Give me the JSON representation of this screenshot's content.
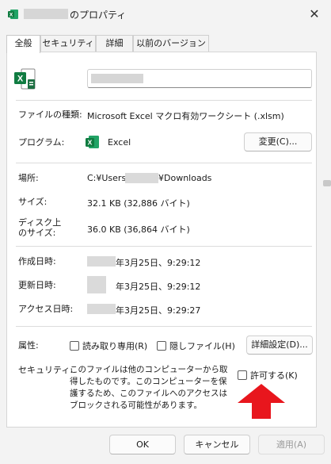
{
  "window": {
    "title_suffix": "のプロパティ",
    "close_glyph": "✕"
  },
  "tabs": [
    {
      "label": "全般",
      "active": true
    },
    {
      "label": "セキュリティ",
      "active": false
    },
    {
      "label": "詳細",
      "active": false
    },
    {
      "label": "以前のバージョン",
      "active": false
    }
  ],
  "general": {
    "file_type_label": "ファイルの種類:",
    "file_type_value": "Microsoft Excel マクロ有効ワークシート (.xlsm)",
    "program_label": "プログラム:",
    "program_value": "Excel",
    "change_button": "変更(C)...",
    "location_label": "場所:",
    "location_prefix": "C:¥Users¥",
    "location_suffix": "¥Downloads",
    "size_label": "サイズ:",
    "size_value": "32.1 KB (32,886 バイト)",
    "disk_size_label_1": "ディスク上",
    "disk_size_label_2": "のサイズ:",
    "disk_size_value": "36.0 KB (36,864 バイト)",
    "created_label": "作成日時:",
    "created_value": "年3月25日、9:29:12",
    "modified_label": "更新日時:",
    "modified_value": "年3月25日、9:29:12",
    "accessed_label": "アクセス日時:",
    "accessed_value": "年3月25日、9:29:27",
    "attributes_label": "属性:",
    "readonly_label": "読み取り専用(R)",
    "hidden_label": "隠しファイル(H)",
    "advanced_button": "詳細設定(D)...",
    "security_label": "セキュリティ:",
    "security_text": "このファイルは他のコンピューターから取得したものです。このコンピューターを保護するため、このファイルへのアクセスはブロックされる可能性があります。",
    "unblock_label": "許可する(K)"
  },
  "footer": {
    "ok": "OK",
    "cancel": "キャンセル",
    "apply": "適用(A)"
  },
  "colors": {
    "excel_green": "#107c41",
    "arrow_red": "#e8161d",
    "disabled_text": "#9a9a9a"
  },
  "icons": {
    "app": "excel-icon",
    "file": "excel-macro-file-icon",
    "program": "excel-icon",
    "annotation": "red-up-arrow"
  }
}
